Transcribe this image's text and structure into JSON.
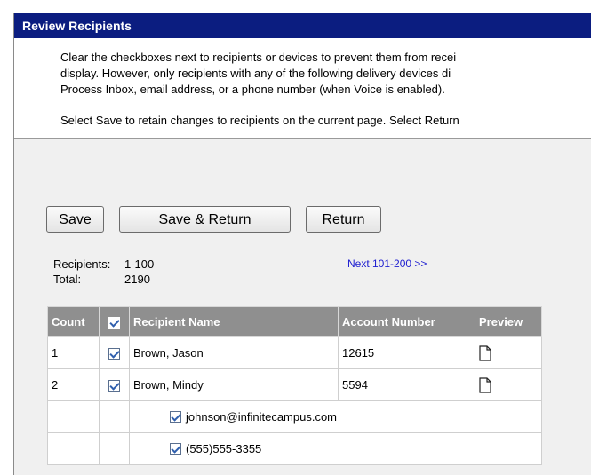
{
  "window": {
    "title": "Review Recipients"
  },
  "instructions": {
    "line1": "Clear the checkboxes next to recipients or devices to prevent them from recei",
    "line2": "display. However, only recipients with any of the following delivery devices di",
    "line3": "Process Inbox, email address, or a phone number (when Voice is enabled).",
    "line4": "Select Save to retain changes to recipients on the current page. Select Return"
  },
  "toolbar": {
    "save_label": "Save",
    "save_return_label": "Save & Return",
    "return_label": "Return"
  },
  "stats": {
    "recipients_label": "Recipients:",
    "recipients_value": "1-100",
    "total_label": "Total:",
    "total_value": "2190",
    "next_link": "Next 101-200 >>"
  },
  "table": {
    "headers": {
      "count": "Count",
      "name": "Recipient Name",
      "account": "Account Number",
      "preview": "Preview"
    },
    "rows": [
      {
        "count": "1",
        "name": "Brown, Jason",
        "account": "12615",
        "checked": true
      },
      {
        "count": "2",
        "name": "Brown, Mindy",
        "account": "5594",
        "checked": true
      }
    ],
    "devices": [
      {
        "label": "johnson@infinitecampus.com",
        "checked": true
      },
      {
        "label": "(555)555-3355",
        "checked": true
      }
    ]
  },
  "colors": {
    "title_bar": "#0b1d80",
    "header_bg": "#8f8f8f",
    "link": "#2020d0"
  }
}
